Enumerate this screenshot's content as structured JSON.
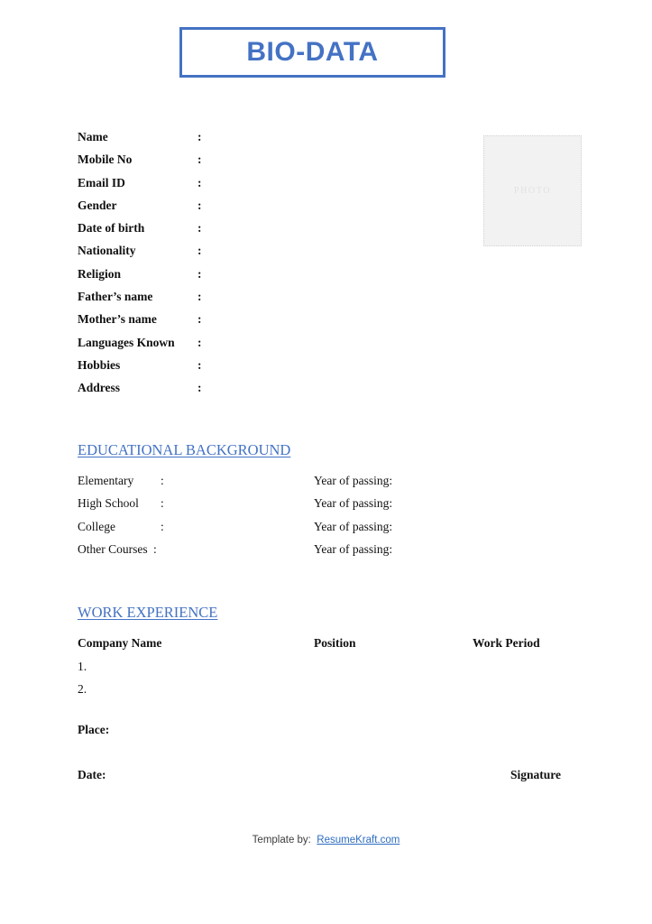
{
  "document": {
    "title": "BIO-DATA"
  },
  "theme": {
    "accent_blue": "#4472C4",
    "link_blue": "#2d6cc0",
    "text_black": "#111111",
    "photo_fill": "#f2f2f2",
    "photo_border": "#d4d4d4"
  },
  "personal": {
    "colon": ":",
    "rows": [
      {
        "label": "Name",
        "value": ""
      },
      {
        "label": "Mobile No",
        "value": ""
      },
      {
        "label": "Email ID",
        "value": ""
      },
      {
        "label": "Gender",
        "value": ""
      },
      {
        "label": "Date of birth",
        "value": ""
      },
      {
        "label": "Nationality",
        "value": ""
      },
      {
        "label": "Religion",
        "value": ""
      },
      {
        "label": "Father’s name",
        "value": ""
      },
      {
        "label": "Mother’s name",
        "value": ""
      },
      {
        "label": "Languages Known",
        "value": ""
      },
      {
        "label": "Hobbies",
        "value": ""
      },
      {
        "label": "Address",
        "value": ""
      }
    ]
  },
  "photo": {
    "label": "PHOTO"
  },
  "education": {
    "heading": "EDUCATIONAL BACKGROUND",
    "colon": ":",
    "year_label": "Year of passing:",
    "rows": [
      {
        "label": "Elementary",
        "value": "",
        "year": ""
      },
      {
        "label": "High School",
        "value": "",
        "year": ""
      },
      {
        "label": "College",
        "value": "",
        "year": ""
      },
      {
        "label": "Other Courses",
        "value": "",
        "year": ""
      }
    ]
  },
  "work": {
    "heading": "WORK EXPERIENCE",
    "columns": {
      "company": "Company Name",
      "position": "Position",
      "period": "Work Period"
    },
    "rows": [
      {
        "index": "1.",
        "company": "",
        "position": "",
        "period": ""
      },
      {
        "index": "2.",
        "company": "",
        "position": "",
        "period": ""
      }
    ]
  },
  "signoff": {
    "place_label": "Place:",
    "date_label": "Date:",
    "signature_label": "Signature"
  },
  "footer": {
    "prefix": "Template by:",
    "link_text": "ResumeKraft.com"
  }
}
